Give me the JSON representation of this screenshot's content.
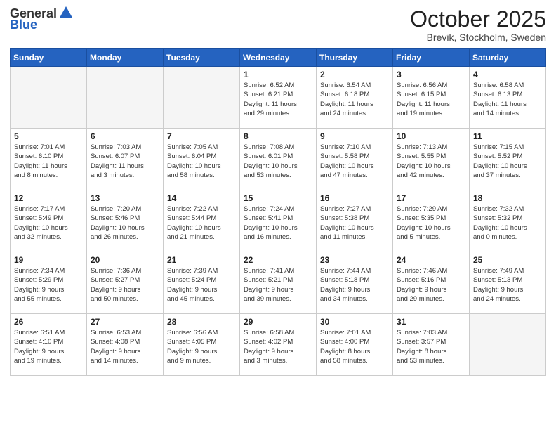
{
  "header": {
    "logo_text_general": "General",
    "logo_text_blue": "Blue",
    "month": "October 2025",
    "location": "Brevik, Stockholm, Sweden"
  },
  "weekdays": [
    "Sunday",
    "Monday",
    "Tuesday",
    "Wednesday",
    "Thursday",
    "Friday",
    "Saturday"
  ],
  "weeks": [
    [
      {
        "day": "",
        "info": ""
      },
      {
        "day": "",
        "info": ""
      },
      {
        "day": "",
        "info": ""
      },
      {
        "day": "1",
        "info": "Sunrise: 6:52 AM\nSunset: 6:21 PM\nDaylight: 11 hours\nand 29 minutes."
      },
      {
        "day": "2",
        "info": "Sunrise: 6:54 AM\nSunset: 6:18 PM\nDaylight: 11 hours\nand 24 minutes."
      },
      {
        "day": "3",
        "info": "Sunrise: 6:56 AM\nSunset: 6:15 PM\nDaylight: 11 hours\nand 19 minutes."
      },
      {
        "day": "4",
        "info": "Sunrise: 6:58 AM\nSunset: 6:13 PM\nDaylight: 11 hours\nand 14 minutes."
      }
    ],
    [
      {
        "day": "5",
        "info": "Sunrise: 7:01 AM\nSunset: 6:10 PM\nDaylight: 11 hours\nand 8 minutes."
      },
      {
        "day": "6",
        "info": "Sunrise: 7:03 AM\nSunset: 6:07 PM\nDaylight: 11 hours\nand 3 minutes."
      },
      {
        "day": "7",
        "info": "Sunrise: 7:05 AM\nSunset: 6:04 PM\nDaylight: 10 hours\nand 58 minutes."
      },
      {
        "day": "8",
        "info": "Sunrise: 7:08 AM\nSunset: 6:01 PM\nDaylight: 10 hours\nand 53 minutes."
      },
      {
        "day": "9",
        "info": "Sunrise: 7:10 AM\nSunset: 5:58 PM\nDaylight: 10 hours\nand 47 minutes."
      },
      {
        "day": "10",
        "info": "Sunrise: 7:13 AM\nSunset: 5:55 PM\nDaylight: 10 hours\nand 42 minutes."
      },
      {
        "day": "11",
        "info": "Sunrise: 7:15 AM\nSunset: 5:52 PM\nDaylight: 10 hours\nand 37 minutes."
      }
    ],
    [
      {
        "day": "12",
        "info": "Sunrise: 7:17 AM\nSunset: 5:49 PM\nDaylight: 10 hours\nand 32 minutes."
      },
      {
        "day": "13",
        "info": "Sunrise: 7:20 AM\nSunset: 5:46 PM\nDaylight: 10 hours\nand 26 minutes."
      },
      {
        "day": "14",
        "info": "Sunrise: 7:22 AM\nSunset: 5:44 PM\nDaylight: 10 hours\nand 21 minutes."
      },
      {
        "day": "15",
        "info": "Sunrise: 7:24 AM\nSunset: 5:41 PM\nDaylight: 10 hours\nand 16 minutes."
      },
      {
        "day": "16",
        "info": "Sunrise: 7:27 AM\nSunset: 5:38 PM\nDaylight: 10 hours\nand 11 minutes."
      },
      {
        "day": "17",
        "info": "Sunrise: 7:29 AM\nSunset: 5:35 PM\nDaylight: 10 hours\nand 5 minutes."
      },
      {
        "day": "18",
        "info": "Sunrise: 7:32 AM\nSunset: 5:32 PM\nDaylight: 10 hours\nand 0 minutes."
      }
    ],
    [
      {
        "day": "19",
        "info": "Sunrise: 7:34 AM\nSunset: 5:29 PM\nDaylight: 9 hours\nand 55 minutes."
      },
      {
        "day": "20",
        "info": "Sunrise: 7:36 AM\nSunset: 5:27 PM\nDaylight: 9 hours\nand 50 minutes."
      },
      {
        "day": "21",
        "info": "Sunrise: 7:39 AM\nSunset: 5:24 PM\nDaylight: 9 hours\nand 45 minutes."
      },
      {
        "day": "22",
        "info": "Sunrise: 7:41 AM\nSunset: 5:21 PM\nDaylight: 9 hours\nand 39 minutes."
      },
      {
        "day": "23",
        "info": "Sunrise: 7:44 AM\nSunset: 5:18 PM\nDaylight: 9 hours\nand 34 minutes."
      },
      {
        "day": "24",
        "info": "Sunrise: 7:46 AM\nSunset: 5:16 PM\nDaylight: 9 hours\nand 29 minutes."
      },
      {
        "day": "25",
        "info": "Sunrise: 7:49 AM\nSunset: 5:13 PM\nDaylight: 9 hours\nand 24 minutes."
      }
    ],
    [
      {
        "day": "26",
        "info": "Sunrise: 6:51 AM\nSunset: 4:10 PM\nDaylight: 9 hours\nand 19 minutes."
      },
      {
        "day": "27",
        "info": "Sunrise: 6:53 AM\nSunset: 4:08 PM\nDaylight: 9 hours\nand 14 minutes."
      },
      {
        "day": "28",
        "info": "Sunrise: 6:56 AM\nSunset: 4:05 PM\nDaylight: 9 hours\nand 9 minutes."
      },
      {
        "day": "29",
        "info": "Sunrise: 6:58 AM\nSunset: 4:02 PM\nDaylight: 9 hours\nand 3 minutes."
      },
      {
        "day": "30",
        "info": "Sunrise: 7:01 AM\nSunset: 4:00 PM\nDaylight: 8 hours\nand 58 minutes."
      },
      {
        "day": "31",
        "info": "Sunrise: 7:03 AM\nSunset: 3:57 PM\nDaylight: 8 hours\nand 53 minutes."
      },
      {
        "day": "",
        "info": ""
      }
    ]
  ]
}
